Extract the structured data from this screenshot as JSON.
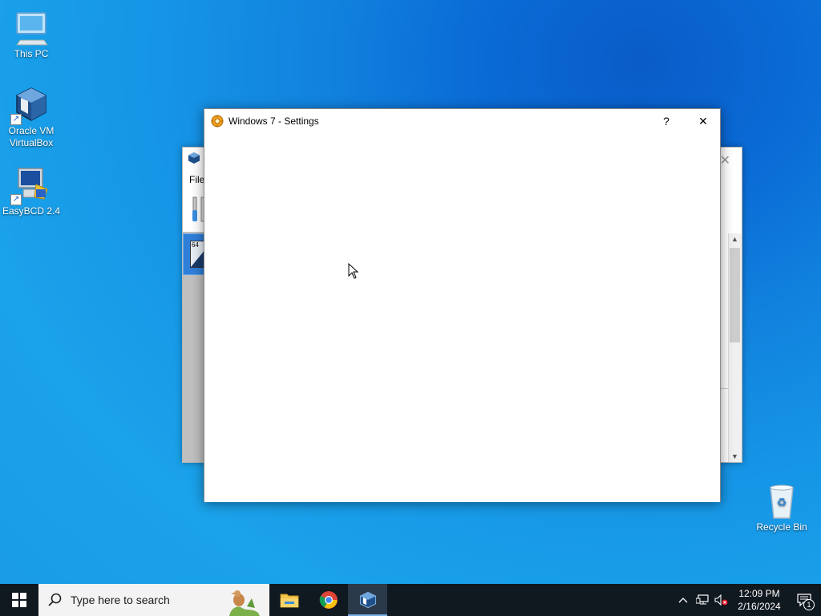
{
  "desktop": {
    "icons": [
      {
        "label": "This PC"
      },
      {
        "label": "Oracle VM VirtualBox"
      },
      {
        "label": "EasyBCD 2.4"
      },
      {
        "label": "Recycle Bin"
      }
    ]
  },
  "vbox_manager": {
    "menu_file": "File",
    "vm_badge": "64"
  },
  "settings_dialog": {
    "title": "Windows 7 - Settings",
    "help_glyph": "?",
    "close_glyph": "✕"
  },
  "taskbar": {
    "search_placeholder": "Type here to search",
    "apps": [
      "file-explorer",
      "chrome",
      "virtualbox"
    ],
    "clock_time": "12:09 PM",
    "clock_date": "2/16/2024",
    "notification_count": "1"
  },
  "colors": {
    "desktop_accent": "#1582de",
    "taskbar": "#101820",
    "vm_selected": "#2f7fd9"
  }
}
